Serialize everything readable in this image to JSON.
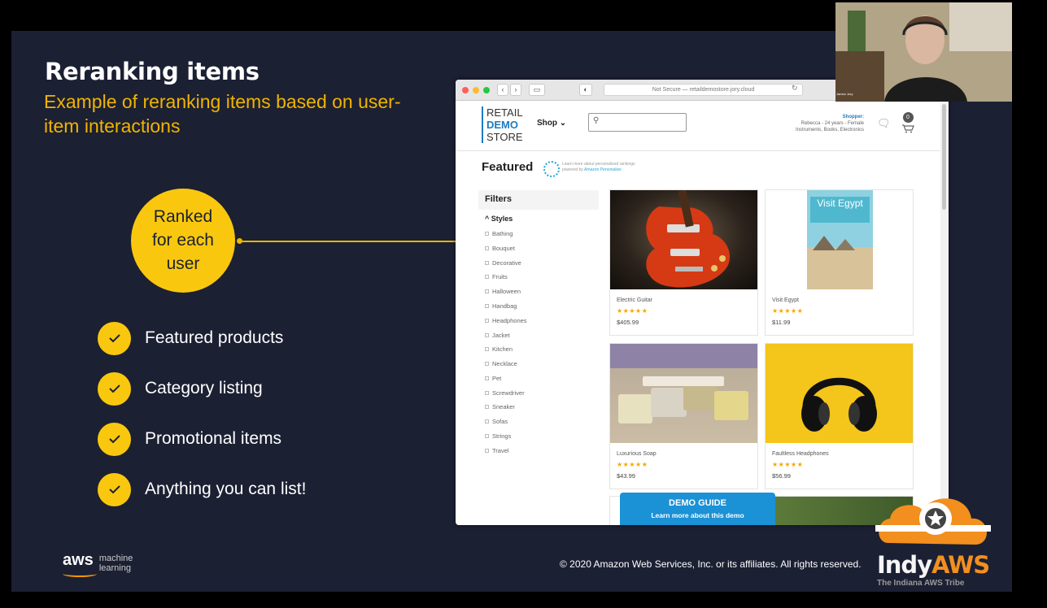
{
  "slide": {
    "title": "Reranking items",
    "subtitle": "Example of reranking items based on user-item interactions",
    "callout": "Ranked\nfor each\nuser",
    "bullets": [
      "Featured products",
      "Category listing",
      "Promotional items",
      "Anything you can list!"
    ],
    "aws_logo_word": "aws",
    "aws_logo_sub": "machine\nlearning",
    "copyright": "© 2020 Amazon Web Services, Inc. or its affiliates. All rights reserved."
  },
  "browser": {
    "url": "Not Secure — retaildemostore.jory.cloud",
    "site": {
      "logo": [
        "RETAIL",
        "DEMO",
        "STORE"
      ],
      "shop_menu": "Shop",
      "search_placeholder": "",
      "shopper_label": "Shopper:",
      "shopper_line1": "Rebecca - 24 years - Female",
      "shopper_line2": "Instruments, Books, Electronics",
      "cart_count": "0",
      "featured_heading": "Featured",
      "personalize_note": "Learn more about personalized rankings",
      "personalize_link_prefix": "powered by",
      "personalize_link": "Amazon Personalize",
      "filters_title": "Filters",
      "styles_title": "Styles",
      "styles": [
        "Bathing",
        "Bouquet",
        "Decorative",
        "Fruits",
        "Halloween",
        "Handbag",
        "Headphones",
        "Jacket",
        "Kitchen",
        "Necklace",
        "Pet",
        "Screwdriver",
        "Sneaker",
        "Sofas",
        "Strings",
        "Travel"
      ],
      "products": [
        {
          "name": "Electric Guitar",
          "stars": "★★★★★",
          "price": "$405.99"
        },
        {
          "name": "Visit Egypt",
          "stars": "★★★★★",
          "price": "$11.99",
          "poster_text": "Visit Egypt"
        },
        {
          "name": "Luxurious Soap",
          "stars": "★★★★★",
          "price": "$43.99"
        },
        {
          "name": "Faultless Headphones",
          "stars": "★★★★★",
          "price": "$56.99"
        }
      ],
      "demo_guide_title": "DEMO GUIDE",
      "demo_guide_sub": "Learn more about this demo"
    }
  },
  "webcam": {
    "name": "James Jory"
  },
  "indy": {
    "prefix": "Indy",
    "aws": "AWS",
    "tagline": "The Indiana AWS Tribe"
  },
  "colors": {
    "slide_bg": "#1c2033",
    "accent": "#f9c80e",
    "aws_orange": "#f28f1e",
    "link_blue": "#1e7abf"
  }
}
